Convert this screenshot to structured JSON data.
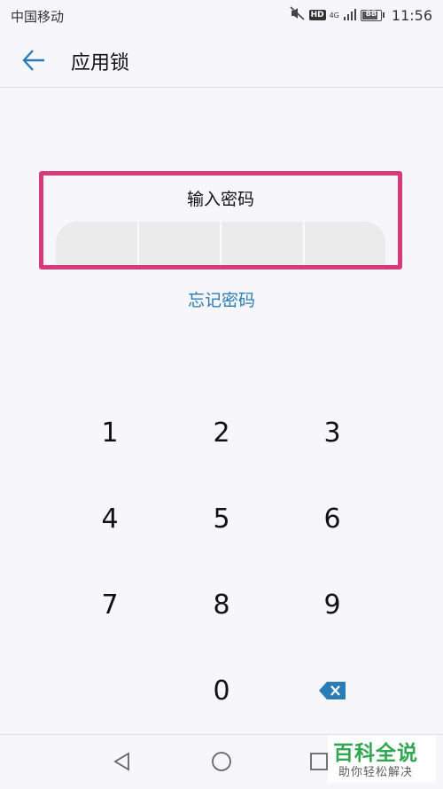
{
  "status_bar": {
    "carrier": "中国移动",
    "network": "4G",
    "hd": "HD",
    "battery": "88",
    "battery_level": 0.88,
    "time": "11:56"
  },
  "header": {
    "title": "应用锁"
  },
  "password": {
    "prompt": "输入密码",
    "digits_count": 4,
    "forgot_label": "忘记密码"
  },
  "keypad": {
    "keys": [
      "1",
      "2",
      "3",
      "4",
      "5",
      "6",
      "7",
      "8",
      "9",
      "0"
    ]
  },
  "watermark": {
    "title": "百科全说",
    "subtitle": "助你轻松解决"
  },
  "colors": {
    "accent": "#2a7db4",
    "highlight_frame": "#d73a79",
    "background": "#f7f6fa",
    "watermark_green": "#27a348"
  },
  "icons": {
    "back": "arrow-left-icon",
    "delete": "backspace-icon",
    "nav_back": "triangle-back-icon",
    "nav_home": "circle-home-icon",
    "nav_recents": "square-recents-icon"
  }
}
